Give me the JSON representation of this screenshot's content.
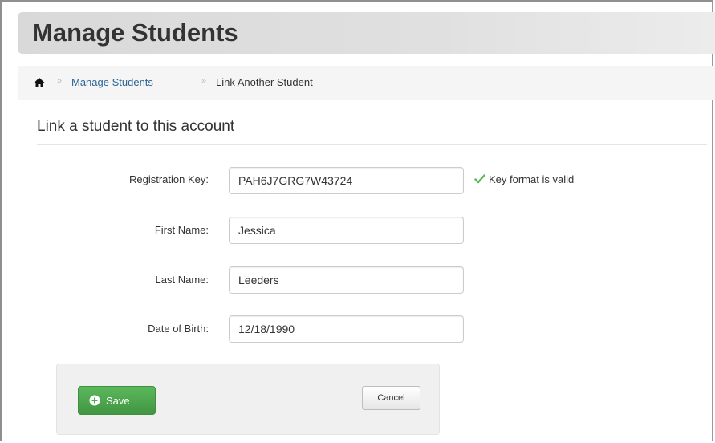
{
  "page": {
    "title": "Manage Students"
  },
  "breadcrumb": {
    "home_icon": "home-icon",
    "separator": "»",
    "link_label": "Manage Students",
    "current_label": "Link Another Student"
  },
  "section": {
    "title": "Link a student to this account"
  },
  "form": {
    "registration_key": {
      "label": "Registration Key:",
      "value": "PAH6J7GRG7W43724",
      "validation_message": "Key format is valid",
      "validation_icon": "checkmark-icon"
    },
    "first_name": {
      "label": "First Name:",
      "value": "Jessica"
    },
    "last_name": {
      "label": "Last Name:",
      "value": "Leeders"
    },
    "date_of_birth": {
      "label": "Date of Birth:",
      "value": "12/18/1990"
    }
  },
  "actions": {
    "save_label": "Save",
    "save_icon": "plus-circle-icon",
    "cancel_label": "Cancel"
  },
  "colors": {
    "save_button": "#5cb85c",
    "link": "#2a6496",
    "valid_check": "#5cb85c",
    "title_bar": "#dcdcdc"
  }
}
